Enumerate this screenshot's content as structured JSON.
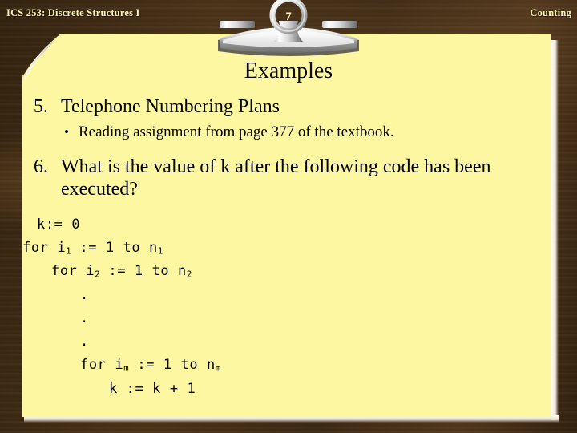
{
  "header": {
    "left_text": "ICS 253: Discrete Structures I",
    "right_text": "Counting",
    "page_number": "7",
    "text_color": "#fbf3b4",
    "background_color": "#3a2817"
  },
  "slide": {
    "title": "Examples",
    "paper_color": "#fcf7a0",
    "text_color": "#000000"
  },
  "items": [
    {
      "number": "5.",
      "text": "Telephone Numbering Plans",
      "sub_bullets": [
        {
          "bullet": "•",
          "text": "Reading assignment from page 377 of the textbook."
        }
      ]
    },
    {
      "number": "6.",
      "text": "What is the value of k after the following code has been executed?",
      "sub_bullets": []
    }
  ],
  "code": {
    "lines": [
      {
        "indent": 1,
        "text": "k:= 0"
      },
      {
        "indent": 0,
        "text": "for i₁ := 1 to n₁"
      },
      {
        "indent": 2,
        "text": "for i₂ := 1 to n₂"
      },
      {
        "indent": 4,
        "text": "."
      },
      {
        "indent": 4,
        "text": "."
      },
      {
        "indent": 4,
        "text": "."
      },
      {
        "indent": 4,
        "text": "for iₘ := 1 to nₘ"
      },
      {
        "indent": 6,
        "text": "k := k + 1"
      }
    ],
    "full_text": "k:= 0\nfor i1 := 1 to n1\n   for i2 := 1 to n2\n      .\n      .\n      .\n      for im := 1 to nm\n         k := k + 1"
  }
}
